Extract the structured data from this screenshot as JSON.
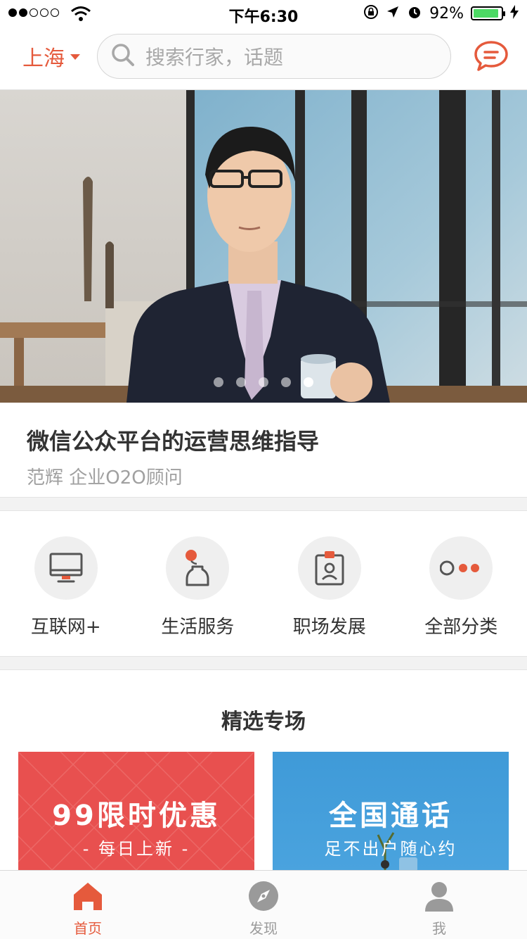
{
  "status_bar": {
    "time": "下午6:30",
    "battery_percent": "92%",
    "battery_level": 0.92,
    "signal_bars": 2,
    "signal_total": 5
  },
  "header": {
    "city": "上海",
    "search_placeholder": "搜索行家，话题",
    "message_icon": "chat-bubble-icon"
  },
  "banner": {
    "slide_count": 5,
    "active_slide": 5
  },
  "feature": {
    "title": "微信公众平台的运营思维指导",
    "subtitle": "范辉 企业O2O顾问"
  },
  "categories": [
    {
      "label": "互联网+",
      "icon": "monitor-icon"
    },
    {
      "label": "生活服务",
      "icon": "flower-vase-icon"
    },
    {
      "label": "职场发展",
      "icon": "badge-icon"
    },
    {
      "label": "全部分类",
      "icon": "more-dots-icon"
    }
  ],
  "section": {
    "title": "精选专场",
    "cards": [
      {
        "title": "99限时优惠",
        "subtitle": "- 每日上新 -",
        "color": "#e8504f"
      },
      {
        "title": "全国通话",
        "subtitle": "足不出户随心约",
        "color": "#4aa3de"
      }
    ]
  },
  "tabbar": {
    "tabs": [
      {
        "label": "首页",
        "icon": "home-icon",
        "active": true
      },
      {
        "label": "发现",
        "icon": "compass-icon",
        "active": false
      },
      {
        "label": "我",
        "icon": "person-icon",
        "active": false
      }
    ]
  },
  "colors": {
    "accent": "#e55a3c",
    "inactive": "#9a9a9a"
  }
}
